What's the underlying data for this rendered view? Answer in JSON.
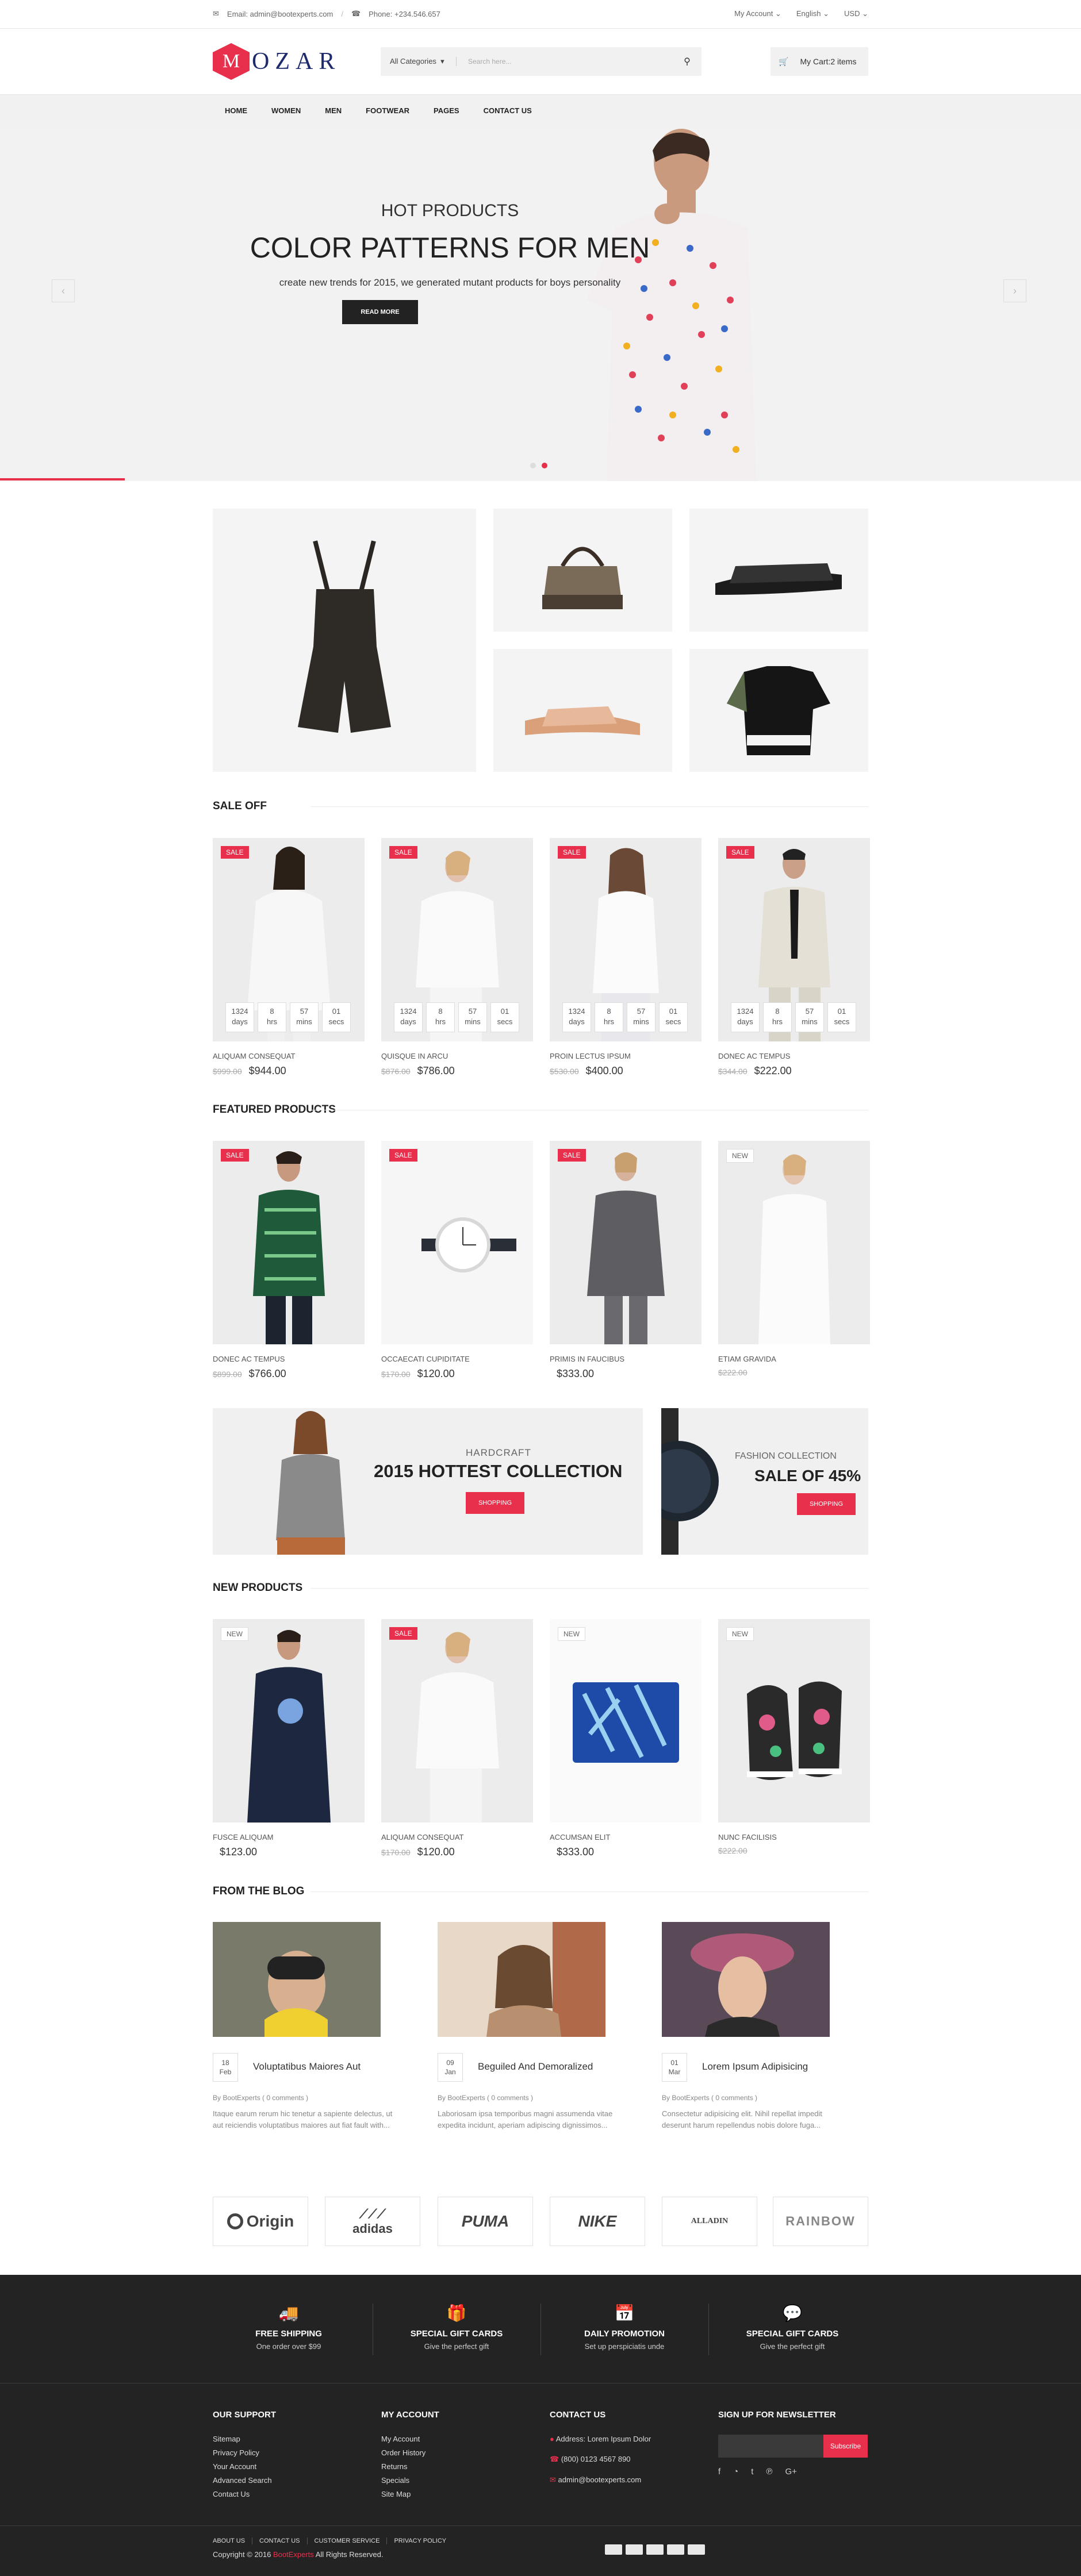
{
  "topbar": {
    "email": "Email: admin@bootexperts.com",
    "phone": "Phone: +234.546.657",
    "account": "My Account",
    "language": "English",
    "currency": "USD"
  },
  "header": {
    "logo_letter": "M",
    "logo_text": "OZAR",
    "category": "All Categories",
    "search_placeholder": "Search here...",
    "cart": "My Cart:2 items"
  },
  "nav": [
    "HOME",
    "WOMEN",
    "MEN",
    "FOOTWEAR",
    "PAGES",
    "CONTACT US"
  ],
  "hero": {
    "subtitle": "HOT PRODUCTS",
    "title": "COLOR PATTERNS FOR MEN",
    "text": "create new trends for 2015, we generated mutant products for boys personality",
    "button": "READ MORE"
  },
  "sections": {
    "sale": "SALE OFF",
    "featured": "FEATURED PRODUCTS",
    "new": "NEW PRODUCTS",
    "blog": "FROM THE BLOG"
  },
  "timer": {
    "days": "1324",
    "hours": "8",
    "mins": "57",
    "secs": "01",
    "l_days": "days",
    "l_hrs": "hrs",
    "l_mins": "mins",
    "l_secs": "secs"
  },
  "sale_products": [
    {
      "badge": "SALE",
      "name": "ALIQUAM CONSEQUAT",
      "old": "$999.00",
      "price": "$944.00"
    },
    {
      "badge": "SALE",
      "name": "QUISQUE IN ARCU",
      "old": "$876.00",
      "price": "$786.00"
    },
    {
      "badge": "SALE",
      "name": "PROIN LECTUS IPSUM",
      "old": "$530.00",
      "price": "$400.00"
    },
    {
      "badge": "SALE",
      "name": "DONEC AC TEMPUS",
      "old": "$344.00",
      "price": "$222.00"
    }
  ],
  "featured_products": [
    {
      "badge": "SALE",
      "name": "DONEC AC TEMPUS",
      "old": "$899.00",
      "price": "$766.00"
    },
    {
      "badge": "SALE",
      "name": "OCCAECATI CUPIDITATE",
      "old": "$170.00",
      "price": "$120.00"
    },
    {
      "badge": "SALE",
      "name": "PRIMIS IN FAUCIBUS",
      "old": "",
      "price": "$333.00"
    },
    {
      "badge": "NEW",
      "name": "ETIAM GRAVIDA",
      "old": "$222.00",
      "price": ""
    }
  ],
  "banners": {
    "b1_small": "HARDCRAFT",
    "b1_title": "2015 HOTTEST COLLECTION",
    "b1_btn": "SHOPPING",
    "b2_small": "FASHION COLLECTION",
    "b2_title": "SALE OF 45%",
    "b2_btn": "SHOPPING"
  },
  "new_products": [
    {
      "badge": "NEW",
      "name": "FUSCE ALIQUAM",
      "old": "",
      "price": "$123.00"
    },
    {
      "badge": "SALE",
      "name": "ALIQUAM CONSEQUAT",
      "old": "$170.00",
      "price": "$120.00"
    },
    {
      "badge": "NEW",
      "name": "ACCUMSAN ELIT",
      "old": "",
      "price": "$333.00"
    },
    {
      "badge": "NEW",
      "name": "NUNC FACILISIS",
      "old": "$222.00",
      "price": ""
    }
  ],
  "blog": [
    {
      "day": "18",
      "mon": "Feb",
      "title": "Voluptatibus Maiores Aut",
      "by": "By BootExperts ( 0 comments )",
      "excerpt": "Itaque earum rerum hic tenetur a sapiente delectus, ut aut reiciendis voluptatibus maiores aut fiat fault with..."
    },
    {
      "day": "09",
      "mon": "Jan",
      "title": "Beguiled And Demoralized",
      "by": "By BootExperts ( 0 comments )",
      "excerpt": "Laboriosam ipsa temporibus magni assumenda vitae expedita incidunt, aperiam adipiscing dignissimos..."
    },
    {
      "day": "01",
      "mon": "Mar",
      "title": "Lorem Ipsum Adipisicing",
      "by": "By BootExperts ( 0 comments )",
      "excerpt": "Consectetur adipisicing elit. Nihil repellat impedit deserunt harum repellendus nobis dolore fuga..."
    }
  ],
  "brands": [
    "Origin",
    "adidas",
    "PUMA",
    "NIKE",
    "ALLADIN",
    "RAINBOW"
  ],
  "features": [
    {
      "icon": "truck-icon",
      "title": "FREE SHIPPING",
      "sub": "One order over $99"
    },
    {
      "icon": "gift-icon",
      "title": "SPECIAL GIFT CARDS",
      "sub": "Give the perfect gift"
    },
    {
      "icon": "calendar-icon",
      "title": "DAILY PROMOTION",
      "sub": "Set up perspiciatis unde"
    },
    {
      "icon": "chat-icon",
      "title": "SPECIAL GIFT CARDS",
      "sub": "Give the perfect gift"
    }
  ],
  "footer": {
    "support_title": "OUR SUPPORT",
    "support": [
      "Sitemap",
      "Privacy Policy",
      "Your Account",
      "Advanced Search",
      "Contact Us"
    ],
    "account_title": "MY ACCOUNT",
    "account": [
      "My Account",
      "Order History",
      "Returns",
      "Specials",
      "Site Map"
    ],
    "contact_title": "CONTACT US",
    "contact": [
      "Address: Lorem Ipsum Dolor",
      "(800) 0123 4567 890",
      "admin@bootexperts.com"
    ],
    "news_title": "SIGN UP FOR NEWSLETTER",
    "subscribe": "Subscribe",
    "bottom_links": [
      "ABOUT US",
      "CONTACT US",
      "CUSTOMER SERVICE",
      "PRIVACY POLICY"
    ],
    "copyright": "Copyright © 2016 ",
    "copy_brand": "BootExperts",
    "copy_rest": " All Rights Reserved."
  },
  "colors": {
    "accent": "#e8304c",
    "dark": "#232323"
  }
}
